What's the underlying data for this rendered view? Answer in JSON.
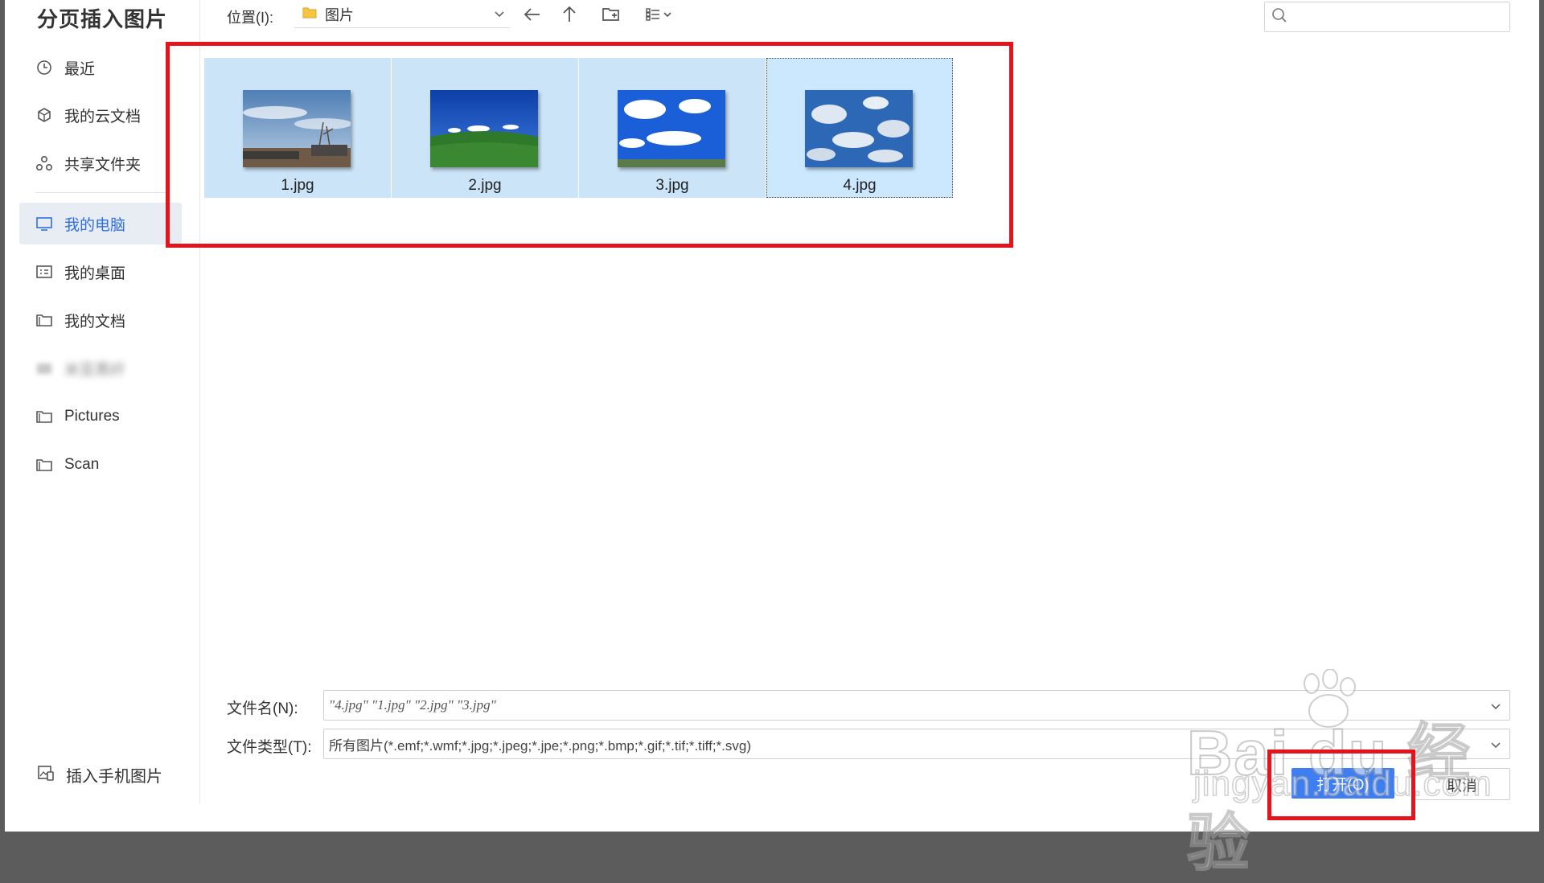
{
  "dialog": {
    "title": "分页插入图片"
  },
  "sidebar": {
    "items": [
      {
        "label": "最近",
        "icon": "clock-icon"
      },
      {
        "label": "我的云文档",
        "icon": "cloud-docs-icon"
      },
      {
        "label": "共享文件夹",
        "icon": "share-folder-icon"
      },
      {
        "label": "我的电脑",
        "icon": "computer-icon",
        "active": true
      },
      {
        "label": "我的桌面",
        "icon": "desktop-icon"
      },
      {
        "label": "我的文档",
        "icon": "folder-icon"
      },
      {
        "label": "米亚黑纤",
        "icon": "folder-icon",
        "blurred": true
      },
      {
        "label": "Pictures",
        "icon": "folder-icon"
      },
      {
        "label": "Scan",
        "icon": "folder-icon"
      }
    ],
    "mobile_label": "插入手机图片"
  },
  "toolbar": {
    "location_label": "位置(I):",
    "location_value": "图片"
  },
  "search": {
    "placeholder": ""
  },
  "files": [
    {
      "name": "1.jpg"
    },
    {
      "name": "2.jpg"
    },
    {
      "name": "3.jpg"
    },
    {
      "name": "4.jpg"
    }
  ],
  "form": {
    "filename_label": "文件名(N):",
    "filename_value": "\"4.jpg\" \"1.jpg\" \"2.jpg\" \"3.jpg\"",
    "filetype_label": "文件类型(T):",
    "filetype_value": "所有图片(*.emf;*.wmf;*.jpg;*.jpeg;*.jpe;*.png;*.bmp;*.gif;*.tif;*.tiff;*.svg)"
  },
  "buttons": {
    "open": "打开(O)",
    "cancel": "取消"
  },
  "watermark": {
    "main": "Bai du 经验",
    "sub": "jingyan.baidu.com"
  },
  "colors": {
    "accent": "#3f7ef0",
    "selection": "#cce4f7",
    "highlight_box": "#e3141b"
  }
}
